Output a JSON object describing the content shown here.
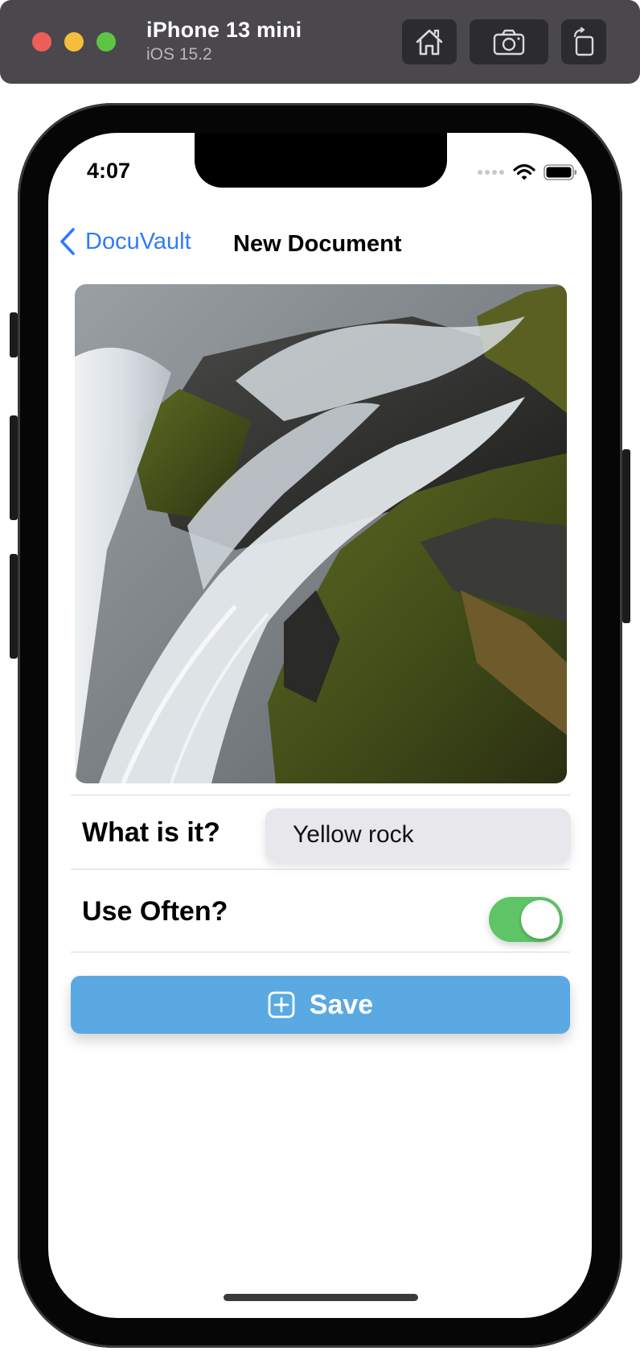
{
  "simulator": {
    "device_name": "iPhone 13 mini",
    "os_version": "iOS 15.2",
    "buttons": [
      "home-icon",
      "screenshot-icon",
      "rotate-icon"
    ]
  },
  "status_bar": {
    "time": "4:07"
  },
  "nav": {
    "back_label": "DocuVault",
    "title": "New Document"
  },
  "form": {
    "what_label": "What is it?",
    "what_value": "Yellow rock",
    "use_often_label": "Use Often?",
    "use_often_on": true,
    "save_label": "Save"
  },
  "colors": {
    "accent_link": "#2f7cf6",
    "toggle_on": "#5ec466",
    "save_button": "#5aa9e2"
  }
}
